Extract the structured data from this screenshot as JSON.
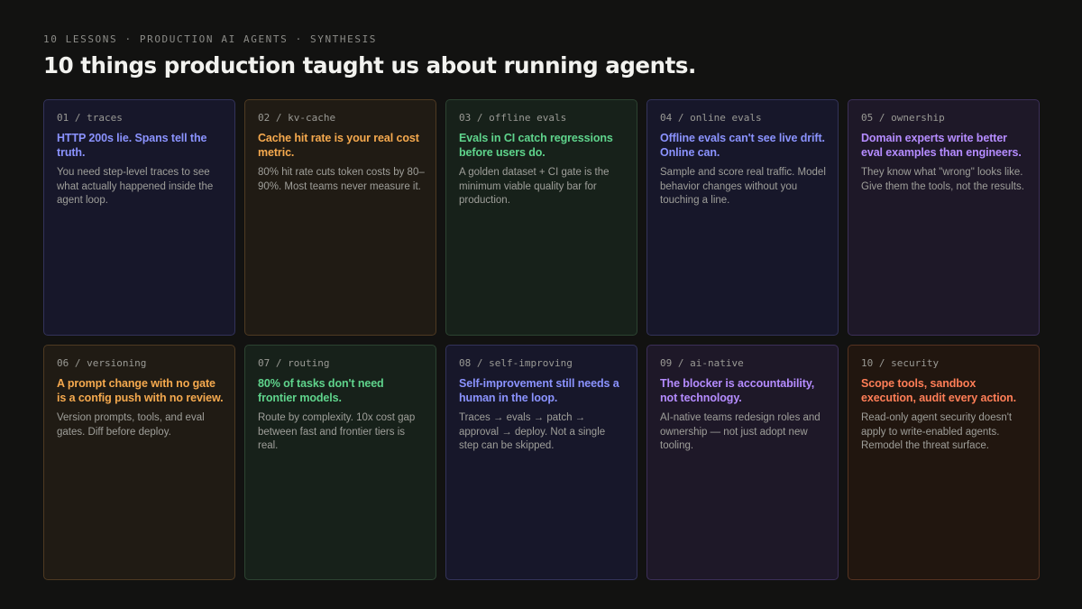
{
  "header": {
    "eyebrow": "10 LESSONS · PRODUCTION AI AGENTS · SYNTHESIS",
    "title": "10 things production taught us about running agents."
  },
  "cards": [
    {
      "tag": "01 / traces",
      "headline": "HTTP 200s lie. Spans tell the truth.",
      "body": "You need step-level traces to see what actually happened inside the agent loop.",
      "accent": "#8b93ff"
    },
    {
      "tag": "02 / kv-cache",
      "headline": "Cache hit rate is your real cost metric.",
      "body": "80% hit rate cuts token costs by 80–90%. Most teams never measure it.",
      "accent": "#f5a94e"
    },
    {
      "tag": "03 / offline evals",
      "headline": "Evals in CI catch regressions before users do.",
      "body": "A golden dataset + CI gate is the minimum viable quality bar for production.",
      "accent": "#5fd48c"
    },
    {
      "tag": "04 / online evals",
      "headline": "Offline evals can't see live drift. Online can.",
      "body": "Sample and score real traffic. Model behavior changes without you touching a line.",
      "accent": "#8b93ff"
    },
    {
      "tag": "05 / ownership",
      "headline": "Domain experts write better eval examples than engineers.",
      "body": "They know what \"wrong\" looks like. Give them the tools, not the results.",
      "accent": "#b58cff"
    },
    {
      "tag": "06 / versioning",
      "headline": "A prompt change with no gate is a config push with no review.",
      "body": "Version prompts, tools, and eval gates. Diff before deploy.",
      "accent": "#f5a94e"
    },
    {
      "tag": "07 / routing",
      "headline": "80% of tasks don't need frontier models.",
      "body": "Route by complexity. 10x cost gap between fast and frontier tiers is real.",
      "accent": "#5fd48c"
    },
    {
      "tag": "08 / self-improving",
      "headline": "Self-improvement still needs a human in the loop.",
      "body": "Traces → evals → patch → approval → deploy. Not a single step can be skipped.",
      "accent": "#8b93ff"
    },
    {
      "tag": "09 / ai-native",
      "headline": "The blocker is accountability, not technology.",
      "body": "AI-native teams redesign roles and ownership — not just adopt new tooling.",
      "accent": "#b58cff"
    },
    {
      "tag": "10 / security",
      "headline": "Scope tools, sandbox execution, audit every action.",
      "body": "Read-only agent security doesn't apply to write-enabled agents. Remodel the threat surface.",
      "accent": "#ff7e57"
    }
  ]
}
